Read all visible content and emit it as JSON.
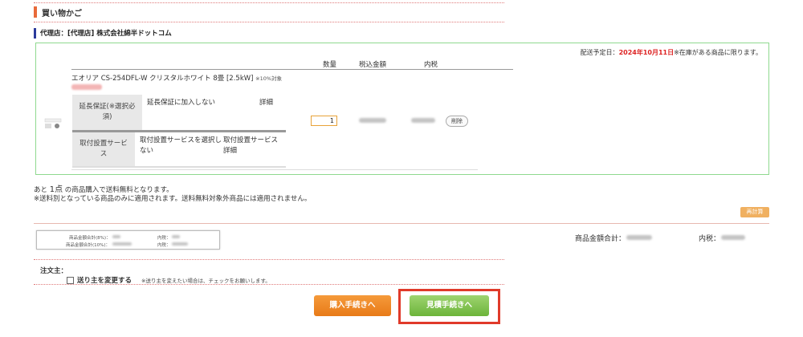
{
  "section": {
    "title": "買い物かご"
  },
  "agent": {
    "title": "代理店：[代理店] 株式会社綿半ドットコム"
  },
  "cart": {
    "delivery_label": "配送予定日：",
    "delivery_date": "2024年10月11日",
    "delivery_note": "※在庫がある商品に限ります。",
    "columns": {
      "qty": "数量",
      "tax_incl": "税込金額",
      "tax": "内税"
    },
    "product": {
      "name": "エオリア CS-254DFL-W クリスタルホワイト 8畳 [2.5kW]",
      "tax_rate_note": "※10%対象",
      "quantity": "1",
      "delete_label": "削除"
    },
    "options": [
      {
        "label": "延長保証(※選択必須)",
        "value": "延長保証に加入しない",
        "detail": "詳細"
      },
      {
        "label": "取付設置サービス",
        "value": "取付設置サービスを選択しない",
        "detail": "取付設置サービス詳細"
      }
    ]
  },
  "notes": {
    "free_ship_pre": "あと ",
    "free_ship_count": "1点",
    "free_ship_post": " の商品購入で送料無料となります。",
    "free_ship_scope": "※送料別となっている商品のみに適用されます。送料無料対象外商品には適用されません。"
  },
  "recalc_label": "再計算",
  "summary": {
    "line1_label": "商品金額合計(8%)：",
    "line1_tax_label": "内税：",
    "line2_label": "商品金額合計(10%)：",
    "line2_tax_label": "内税："
  },
  "totals": {
    "subtotal_label": "商品金額合計：",
    "tax_label": "内税："
  },
  "orderer": {
    "title": "注文主：",
    "change_label": "送り主を変更する",
    "change_note": "※送り主を変えたい場合は、チェックをお願いします。"
  },
  "buttons": {
    "purchase": "購入手続きへ",
    "estimate": "見積手続きへ"
  }
}
